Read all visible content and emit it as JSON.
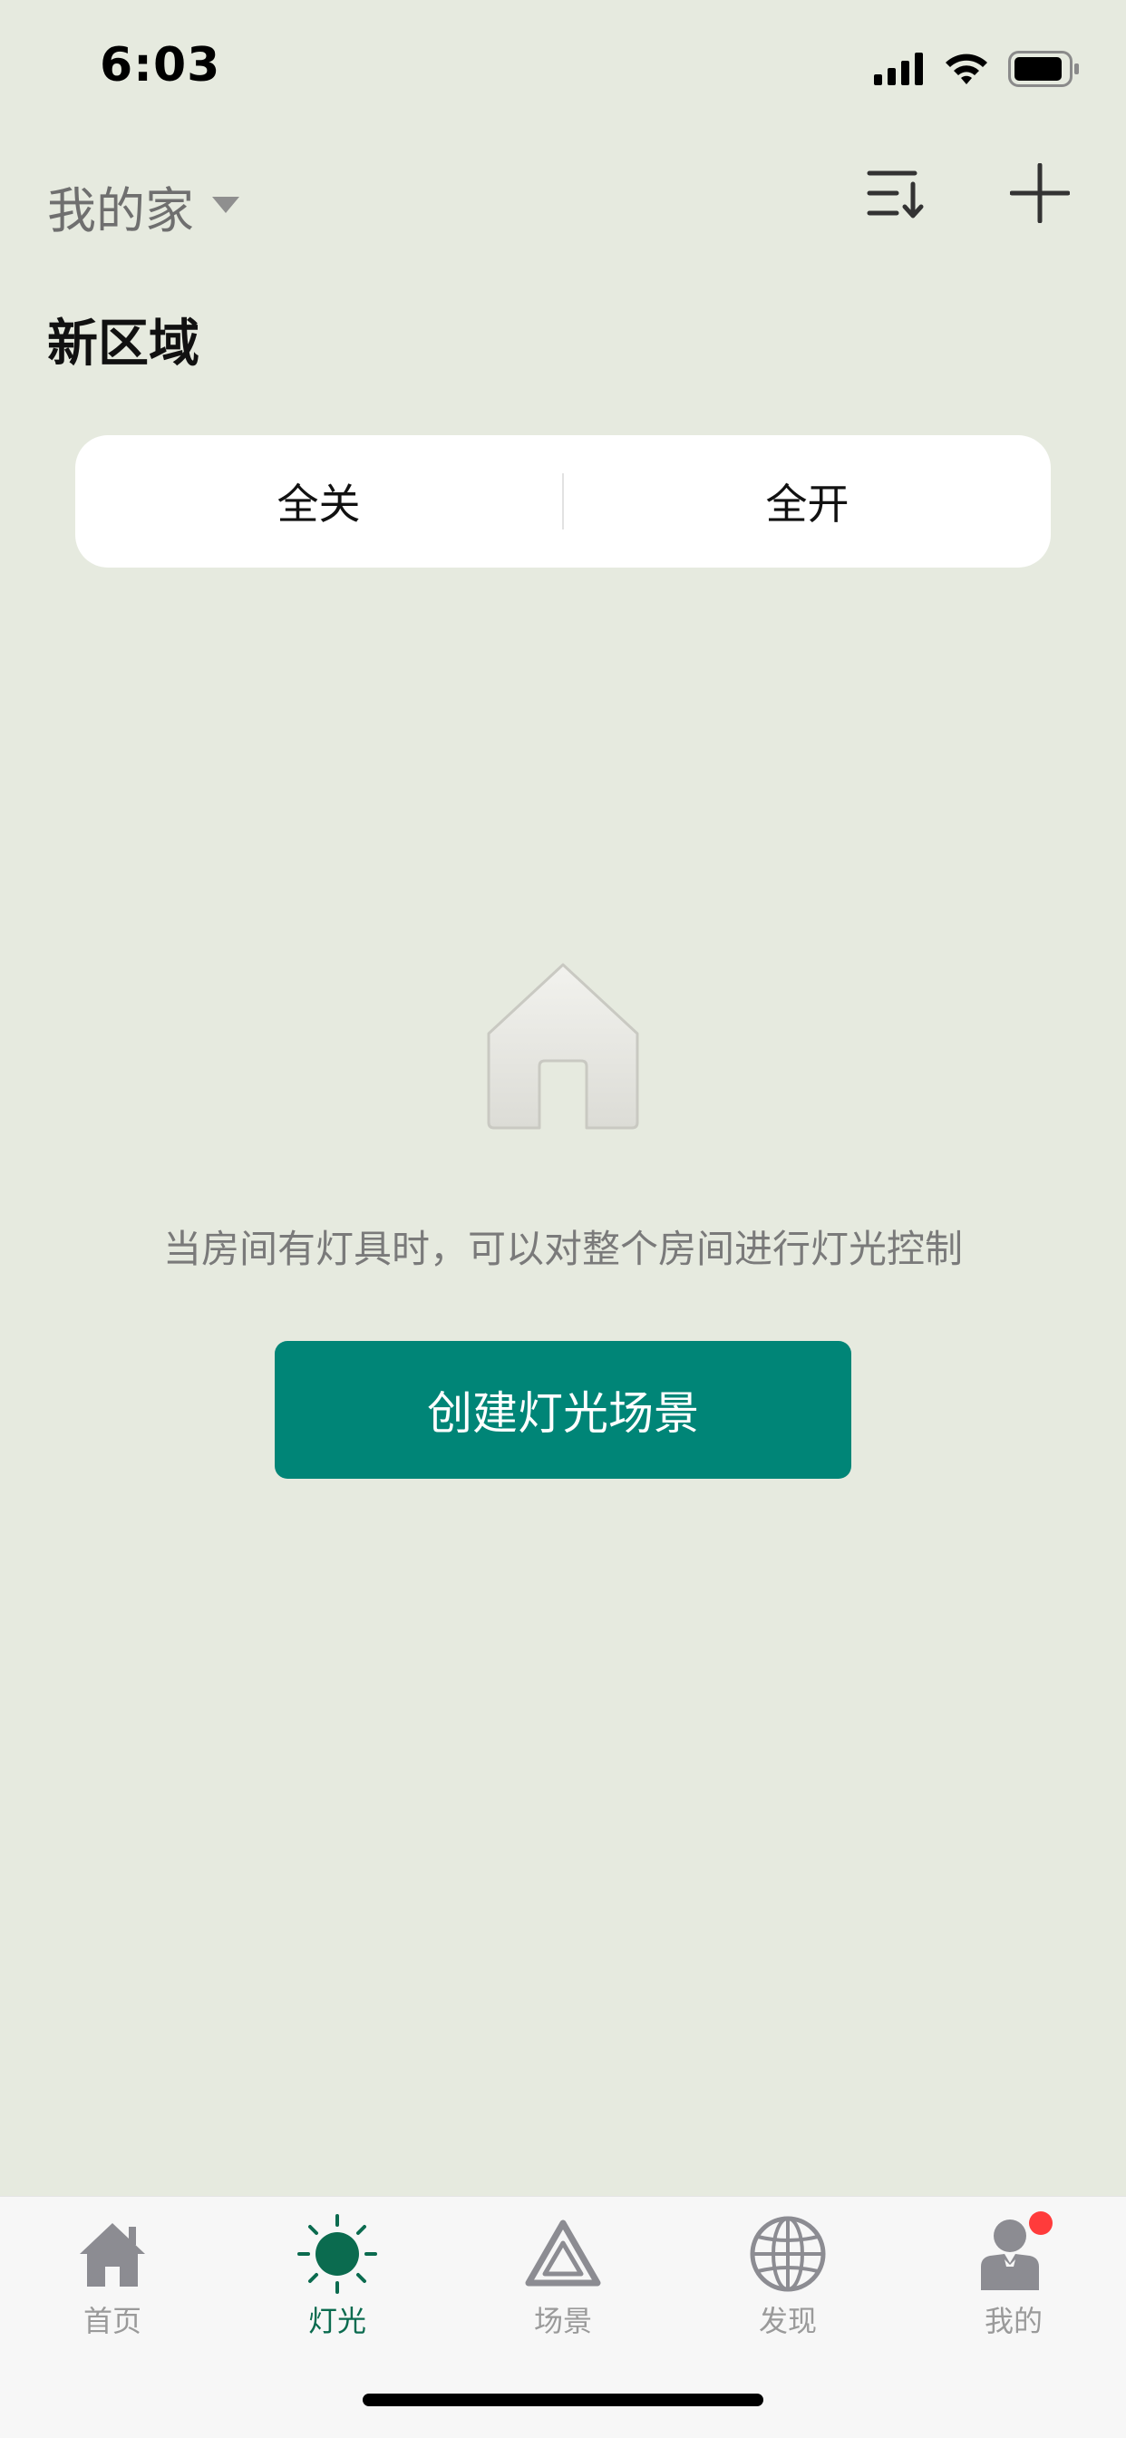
{
  "status_bar": {
    "time": "6:03"
  },
  "header": {
    "home_name": "我的家",
    "icons": [
      "dropdown-caret-icon",
      "sort-icon",
      "plus-icon"
    ]
  },
  "section": {
    "title": "新区域"
  },
  "toggle_card": {
    "all_off": "全关",
    "all_on": "全开"
  },
  "empty_state": {
    "icon": "house-icon",
    "message": "当房间有灯具时，可以对整个房间进行灯光控制",
    "button_label": "创建灯光场景"
  },
  "colors": {
    "background": "#e6eadf",
    "accent": "#008577",
    "active_tab": "#0b6b4f",
    "badge": "#ff3b3b"
  },
  "tabs": [
    {
      "label": "首页",
      "icon": "home-icon",
      "active": false
    },
    {
      "label": "灯光",
      "icon": "light-icon",
      "active": true
    },
    {
      "label": "场景",
      "icon": "scene-icon",
      "active": false
    },
    {
      "label": "发现",
      "icon": "globe-icon",
      "active": false
    },
    {
      "label": "我的",
      "icon": "profile-icon",
      "active": false,
      "badge": true
    }
  ]
}
